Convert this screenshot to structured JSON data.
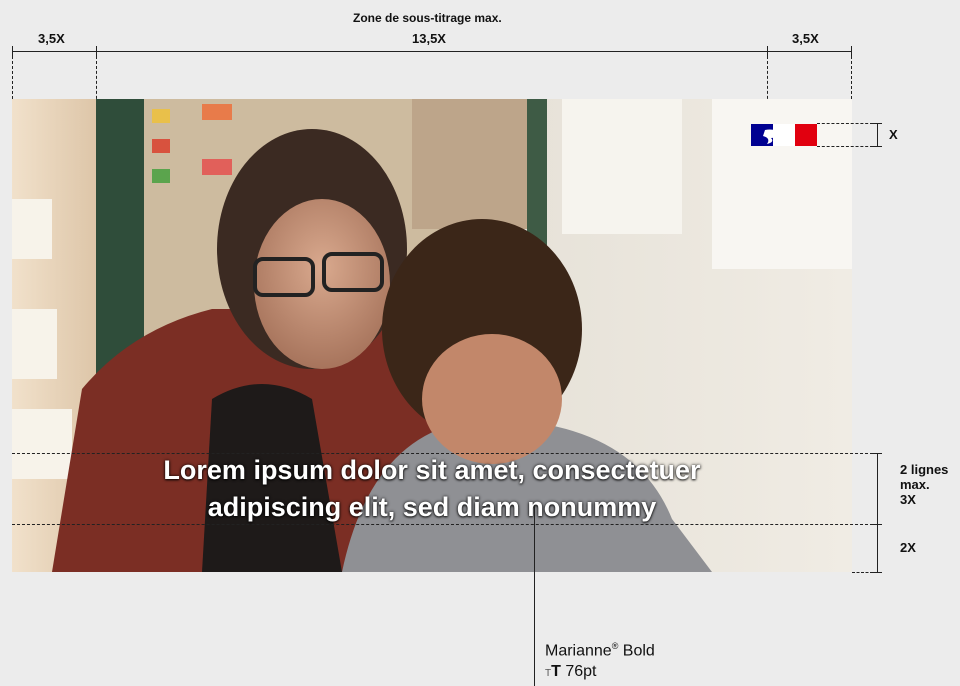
{
  "header": {
    "zone_title": "Zone de sous-titrage max.",
    "left_margin": "3,5X",
    "center_width": "13,5X",
    "right_margin": "3,5X"
  },
  "right_annotations": {
    "logo_height": "X",
    "lines_max_line1": "2 lignes",
    "lines_max_line2": "max.",
    "lines_height": "3X",
    "bottom_margin": "2X"
  },
  "subtitle": {
    "line1": "Lorem ipsum dolor sit amet, consectetuer",
    "line2": "adipiscing elit, sed diam nonummy"
  },
  "font_annotation": {
    "font_name": "Marianne",
    "registered_mark": "®",
    "weight": "Bold",
    "size_icon_glyph": "TT",
    "size": "76pt"
  },
  "colors": {
    "background": "#ececec",
    "flag_blue": "#000091",
    "flag_red": "#e1000f",
    "subtitle_text": "#ffffff"
  },
  "photo": {
    "description_icon": "classroom-photo"
  }
}
